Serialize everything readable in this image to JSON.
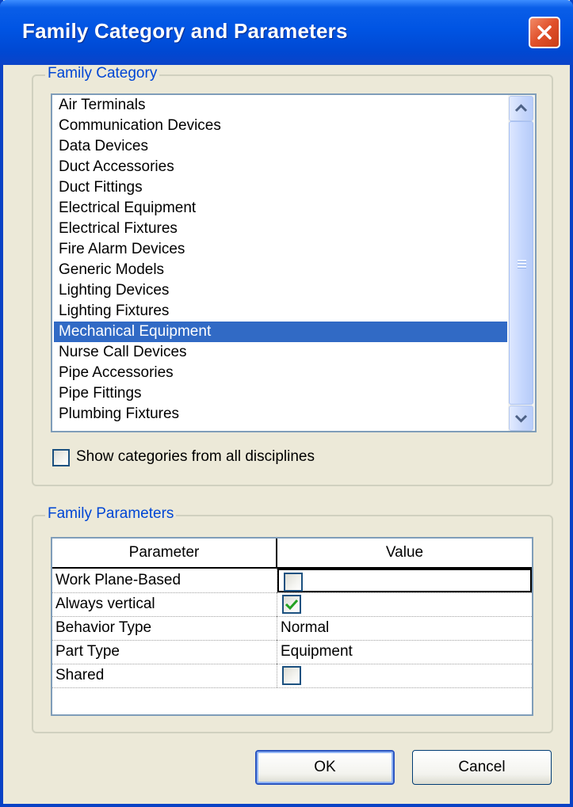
{
  "window": {
    "title": "Family Category and Parameters"
  },
  "family_category": {
    "legend": "Family Category",
    "items": [
      "Air Terminals",
      "Communication Devices",
      "Data Devices",
      "Duct Accessories",
      "Duct Fittings",
      "Electrical Equipment",
      "Electrical Fixtures",
      "Fire Alarm Devices",
      "Generic Models",
      "Lighting Devices",
      "Lighting Fixtures",
      "Mechanical Equipment",
      "Nurse Call Devices",
      "Pipe Accessories",
      "Pipe Fittings",
      "Plumbing Fixtures"
    ],
    "selected": "Mechanical Equipment",
    "show_all_disciplines": {
      "label": "Show categories from all disciplines",
      "checked": false
    }
  },
  "family_parameters": {
    "legend": "Family Parameters",
    "columns": [
      "Parameter",
      "Value"
    ],
    "rows": [
      {
        "parameter": "Work Plane-Based",
        "value": "",
        "kind": "checkbox",
        "checked": false
      },
      {
        "parameter": "Always vertical",
        "value": "",
        "kind": "checkbox",
        "checked": true
      },
      {
        "parameter": "Behavior Type",
        "value": "Normal",
        "kind": "text"
      },
      {
        "parameter": "Part Type",
        "value": "Equipment",
        "kind": "text"
      },
      {
        "parameter": "Shared",
        "value": "",
        "kind": "checkbox",
        "checked": false
      }
    ]
  },
  "buttons": {
    "ok": "OK",
    "cancel": "Cancel"
  },
  "colors": {
    "title_bar": "#0054e3",
    "selection": "#316ac5",
    "group_legend": "#0046d5",
    "check_mark": "#21a121"
  }
}
